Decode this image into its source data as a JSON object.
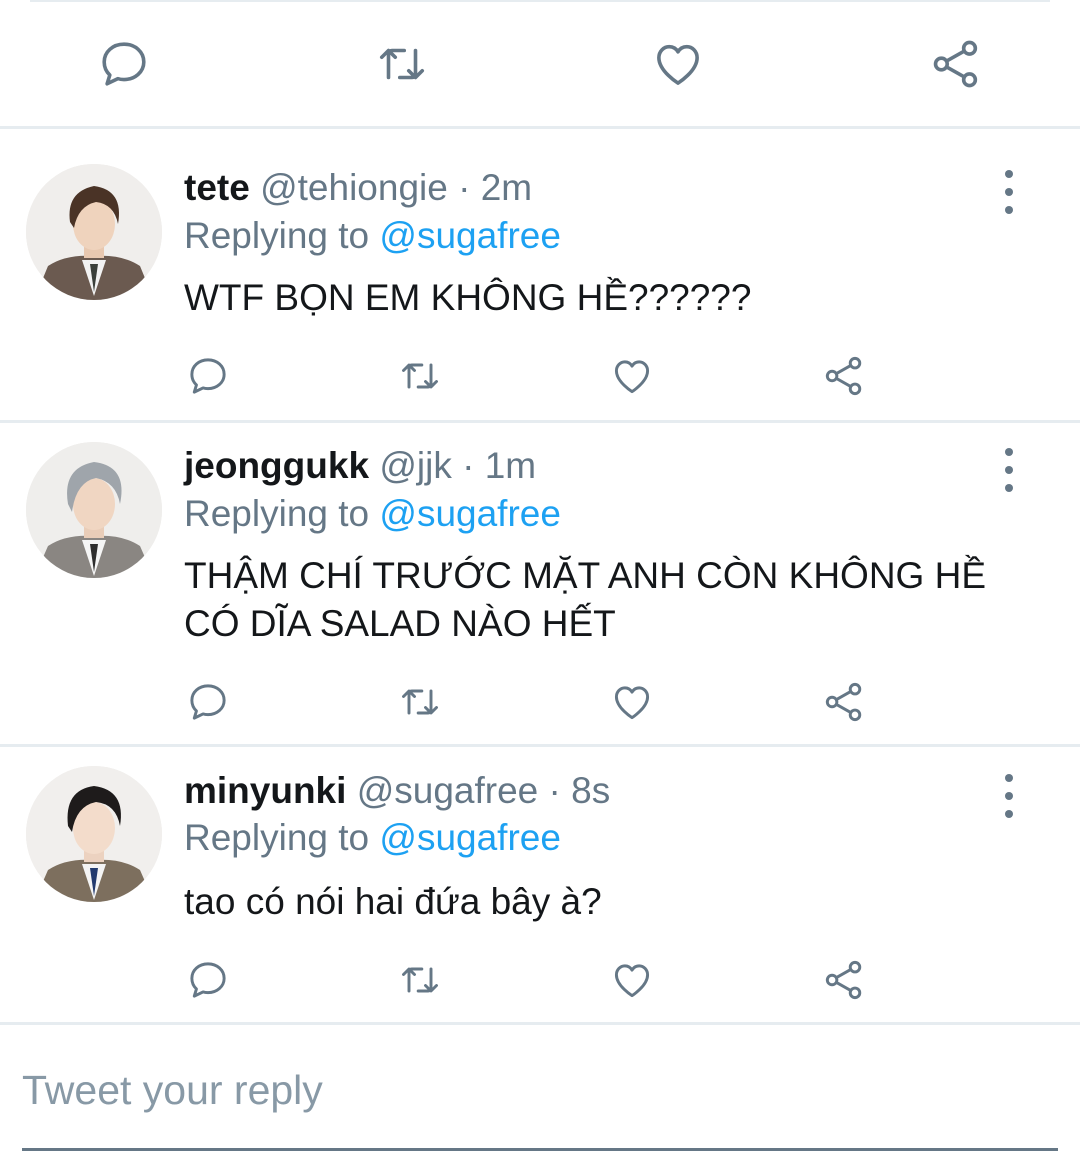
{
  "colors": {
    "accent": "#1da1f2",
    "muted": "#657786",
    "text": "#14171a",
    "divider": "#e6ecf0"
  },
  "main_actions": [
    {
      "icon": "reply-icon"
    },
    {
      "icon": "retweet-icon"
    },
    {
      "icon": "like-icon"
    },
    {
      "icon": "share-icon"
    }
  ],
  "tweets": [
    {
      "name": "tete",
      "handle": "@tehiongie",
      "separator": "·",
      "time": "2m",
      "replying_label": "Replying to",
      "replying_to": "@sugafree",
      "text": "WTF BỌN EM KHÔNG HỀ??????"
    },
    {
      "name": "jeonggukk",
      "handle": "@jjk",
      "separator": "·",
      "time": "1m",
      "replying_label": "Replying to",
      "replying_to": "@sugafree",
      "text": "THẬM CHÍ TRƯỚC MẶT ANH CÒN KHÔNG HỀ CÓ DĨA SALAD NÀO HẾT"
    },
    {
      "name": "minyunki",
      "handle": "@sugafree",
      "separator": "·",
      "time": "8s",
      "replying_label": "Replying to",
      "replying_to": "@sugafree",
      "text": "tao có nói hai đứa bây à?"
    }
  ],
  "compose": {
    "placeholder": "Tweet your reply",
    "value": ""
  }
}
